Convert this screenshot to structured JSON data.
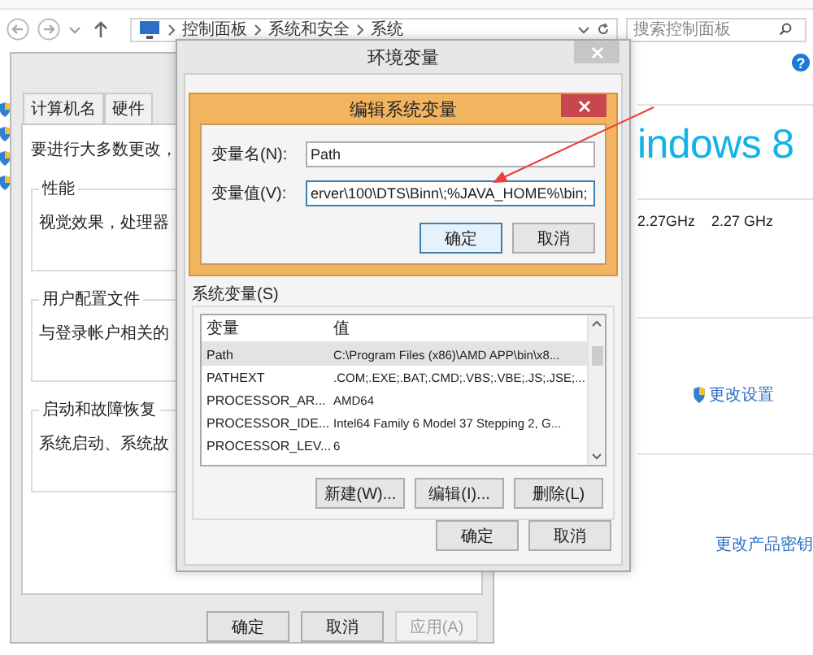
{
  "control_panel": {
    "breadcrumb": [
      "控制面板",
      "系统和安全",
      "系统"
    ],
    "search": {
      "placeholder": "搜索控制面板"
    },
    "help": "?",
    "logo": "indows 8",
    "processor": [
      "2.27GHz",
      "2.27 GHz"
    ],
    "links": [
      "更改设置",
      "更改产品密钥"
    ]
  },
  "system_properties": {
    "tabs": [
      {
        "label": "计算机名",
        "selected": false
      },
      {
        "label": "硬件",
        "selected": false
      }
    ],
    "intro": "要进行大多数更改，",
    "groups": [
      {
        "title": "性能",
        "text": "视觉效果，处理器"
      },
      {
        "title": "用户配置文件",
        "text": "与登录帐户相关的"
      },
      {
        "title": "启动和故障恢复",
        "text": "系统启动、系统故"
      }
    ],
    "buttons": [
      {
        "label": "确定",
        "disabled": false
      },
      {
        "label": "取消",
        "disabled": false
      },
      {
        "label": "应用(A)",
        "disabled": true
      }
    ]
  },
  "environment_variables": {
    "title": "环境变量",
    "system_group": "系统变量(S)",
    "columns": [
      "变量",
      "值"
    ],
    "rows": [
      {
        "name": "Path",
        "value": "C:\\Program Files (x86)\\AMD APP\\bin\\x8...",
        "selected": true
      },
      {
        "name": "PATHEXT",
        "value": ".COM;.EXE;.BAT;.CMD;.VBS;.VBE;.JS;.JSE;...",
        "selected": false
      },
      {
        "name": "PROCESSOR_AR...",
        "value": "AMD64",
        "selected": false
      },
      {
        "name": "PROCESSOR_IDE...",
        "value": "Intel64 Family 6 Model 37 Stepping 2, G...",
        "selected": false
      },
      {
        "name": "PROCESSOR_LEV...",
        "value": "6",
        "selected": false
      }
    ],
    "list_buttons": [
      "新建(W)...",
      "编辑(I)...",
      "删除(L)"
    ],
    "buttons": [
      "确定",
      "取消"
    ]
  },
  "edit_dialog": {
    "title": "编辑系统变量",
    "fields": [
      {
        "label": "变量名(N):",
        "value": "Path"
      },
      {
        "label": "变量值(V):",
        "value": "erver\\100\\DTS\\Binn\\;%JAVA_HOME%\\bin;"
      }
    ],
    "buttons": [
      {
        "label": "确定",
        "default": true
      },
      {
        "label": "取消",
        "default": false
      }
    ]
  }
}
